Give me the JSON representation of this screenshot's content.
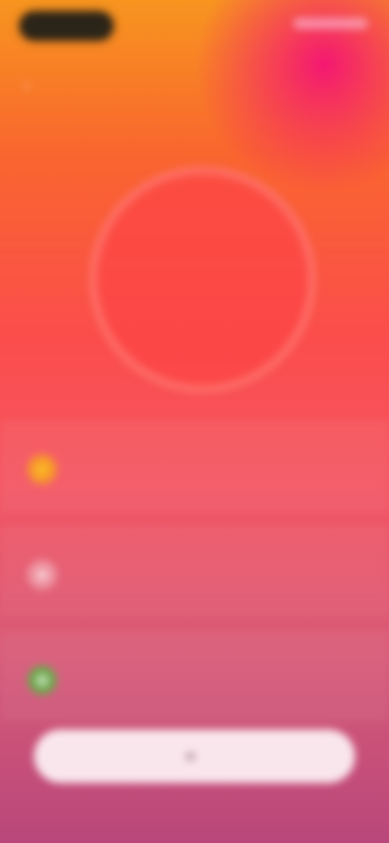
{
  "header": {
    "title": "",
    "back_icon": "chevron-left-icon"
  },
  "ring": {
    "value": "",
    "color": "#fb4d4c"
  },
  "rows": [
    {
      "icon": "lightning-icon",
      "title": "",
      "subtitle": "",
      "value": "",
      "icon_color": "#f69a2a"
    },
    {
      "icon": "drop-icon",
      "title": "",
      "subtitle": "",
      "value": "",
      "icon_color": "#ffffff"
    },
    {
      "icon": "leaf-icon",
      "title": "",
      "subtitle": "",
      "value": "",
      "icon_color": "#6aa84a"
    }
  ],
  "action_button": {
    "label": "",
    "icon": "plus-icon"
  }
}
